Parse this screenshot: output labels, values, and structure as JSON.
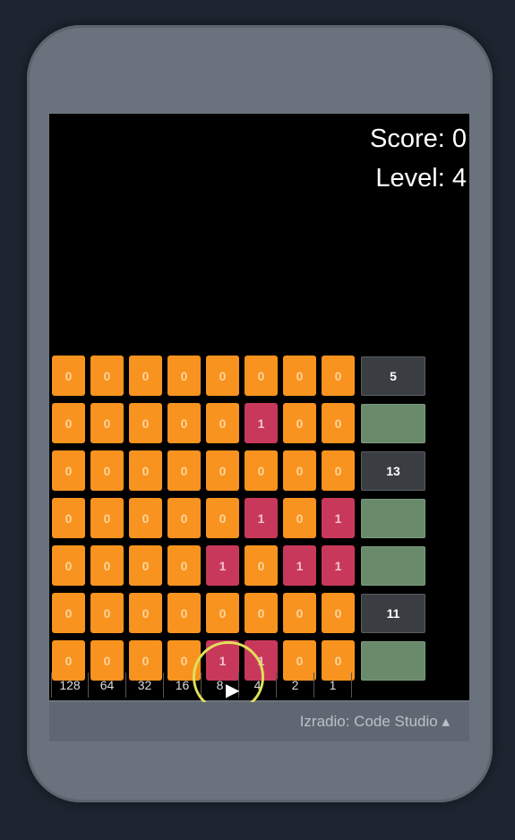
{
  "hud": {
    "score": "Score: 0",
    "level": "Level: 4"
  },
  "grid": [
    {
      "bits": [
        "0",
        "0",
        "0",
        "0",
        "0",
        "0",
        "0",
        "0"
      ],
      "on": [
        false,
        false,
        false,
        false,
        false,
        false,
        false,
        false
      ],
      "answer": "5"
    },
    {
      "bits": [
        "0",
        "0",
        "0",
        "0",
        "0",
        "1",
        "0",
        "0"
      ],
      "on": [
        false,
        false,
        false,
        false,
        false,
        true,
        false,
        false
      ],
      "answer": ""
    },
    {
      "bits": [
        "0",
        "0",
        "0",
        "0",
        "0",
        "0",
        "0",
        "0"
      ],
      "on": [
        false,
        false,
        false,
        false,
        false,
        false,
        false,
        false
      ],
      "answer": "13"
    },
    {
      "bits": [
        "0",
        "0",
        "0",
        "0",
        "0",
        "1",
        "0",
        "1"
      ],
      "on": [
        false,
        false,
        false,
        false,
        false,
        true,
        false,
        true
      ],
      "answer": ""
    },
    {
      "bits": [
        "0",
        "0",
        "0",
        "0",
        "1",
        "0",
        "1",
        "1"
      ],
      "on": [
        false,
        false,
        false,
        false,
        true,
        false,
        true,
        true
      ],
      "answer": ""
    },
    {
      "bits": [
        "0",
        "0",
        "0",
        "0",
        "0",
        "0",
        "0",
        "0"
      ],
      "on": [
        false,
        false,
        false,
        false,
        false,
        false,
        false,
        false
      ],
      "answer": "11"
    },
    {
      "bits": [
        "0",
        "0",
        "0",
        "0",
        "1",
        "1",
        "0",
        "0"
      ],
      "on": [
        false,
        false,
        false,
        false,
        true,
        true,
        false,
        false
      ],
      "answer": ""
    }
  ],
  "place_values": [
    "128",
    "64",
    "32",
    "16",
    "8",
    "4",
    "2",
    "1"
  ],
  "footer": {
    "text": "Izradio: Code Studio ▴"
  },
  "colors": {
    "bit_off": "#f7931e",
    "bit_on": "#c8385a",
    "answer_box": "#3a3d41",
    "answer_empty": "#6a8a6c"
  }
}
